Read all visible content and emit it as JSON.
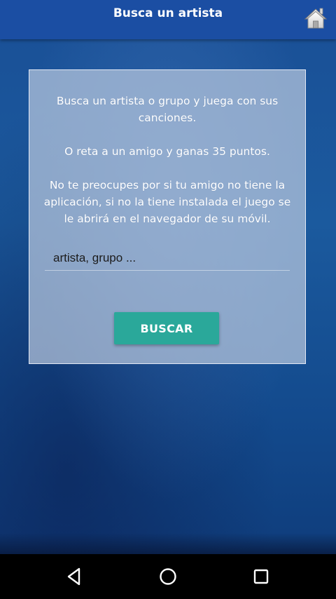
{
  "app_bar": {
    "title": "Busca un artista",
    "home_icon": "home-icon"
  },
  "card": {
    "message_1": "Busca un artista o grupo y juega con sus canciones.",
    "message_2": "O reta a un amigo y ganas 35 puntos.",
    "message_3": "No te preocupes por si tu amigo no tiene la aplicación, si no la tiene instalada el juego se le abrirá en el navegador de su móvil.",
    "search": {
      "placeholder": "artista, grupo ...",
      "value": ""
    },
    "search_button_label": "BUSCAR"
  },
  "nav_bar": {
    "back_icon": "back-triangle-icon",
    "home_icon": "home-circle-icon",
    "recents_icon": "recents-square-icon"
  },
  "colors": {
    "app_bar": "#1b4ea3",
    "background": "#1b5a9e",
    "button": "#2aa89a",
    "card": "#b9c8de"
  }
}
